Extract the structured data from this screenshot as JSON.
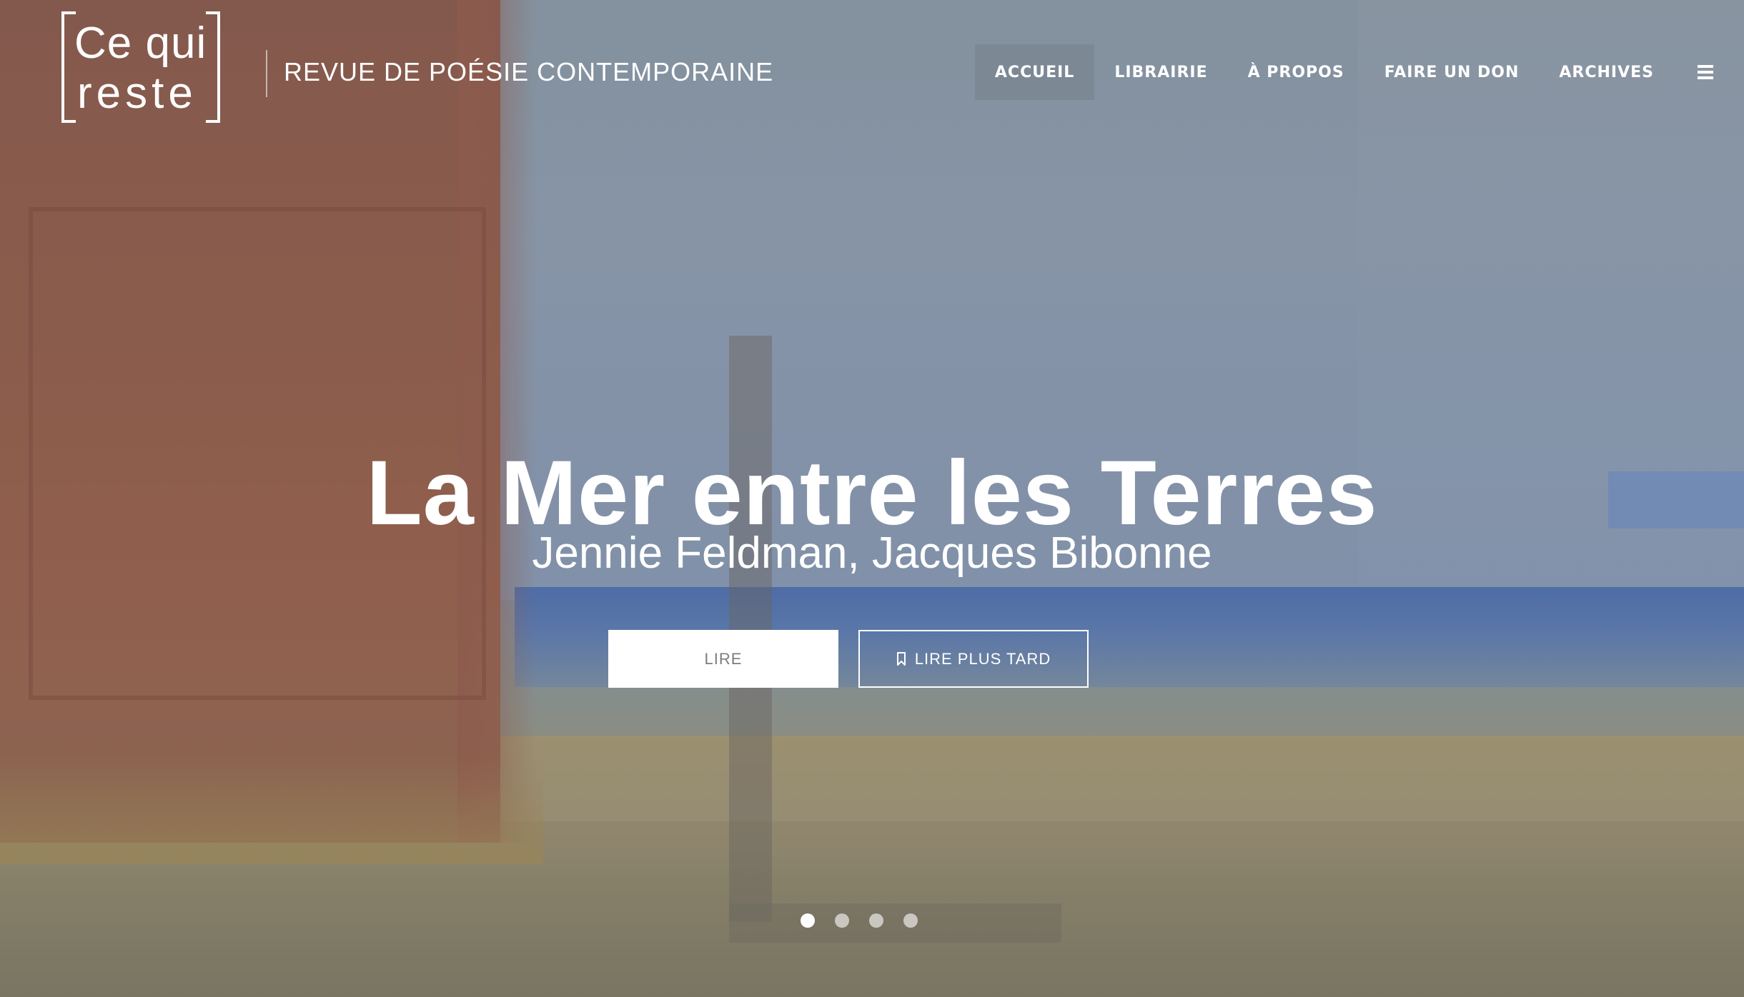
{
  "site": {
    "logo_line1": "Ce qui",
    "logo_line2": "reste",
    "tagline": "REVUE DE POÉSIE CONTEMPORAINE"
  },
  "nav": {
    "items": [
      {
        "label": "ACCUEIL",
        "active": true
      },
      {
        "label": "LIBRAIRIE",
        "active": false
      },
      {
        "label": "À PROPOS",
        "active": false
      },
      {
        "label": "FAIRE UN DON",
        "active": false
      },
      {
        "label": "ARCHIVES",
        "active": false
      }
    ],
    "menu_icon": "hamburger-icon"
  },
  "hero": {
    "title": "La Mer entre les Terres",
    "authors": "Jennie Feldman, Jacques Bibonne",
    "read_label": "LIRE",
    "read_later_label": "LIRE PLUS TARD",
    "read_later_icon": "bookmark-icon"
  },
  "carousel": {
    "slide_count": 4,
    "active_index": 0
  },
  "colors": {
    "text": "#ffffff",
    "button_text": "#7d7d7d",
    "active_nav_bg": "#78808c"
  }
}
